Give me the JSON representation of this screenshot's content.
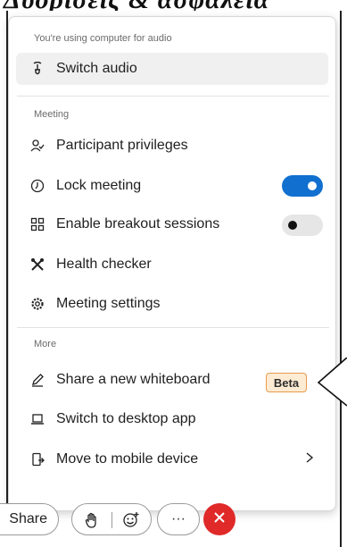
{
  "background_heading": "Δυορίσεις & ασφάλεια",
  "menu": {
    "audio_caption": "You're using computer for audio",
    "switch_audio": "Switch audio",
    "meeting_caption": "Meeting",
    "participant_privileges": "Participant privileges",
    "lock_meeting": "Lock meeting",
    "lock_meeting_on": true,
    "enable_breakout": "Enable breakout sessions",
    "enable_breakout_on": false,
    "health_checker": "Health checker",
    "meeting_settings": "Meeting settings",
    "more_caption": "More",
    "share_whiteboard": "Share a new whiteboard",
    "beta_badge": "Beta",
    "switch_desktop": "Switch to desktop app",
    "move_mobile": "Move to mobile device"
  },
  "toolbar": {
    "share_label": "Share",
    "more_glyph": "···"
  },
  "colors": {
    "toggle_on": "#1170cf",
    "end_call": "#e02929",
    "beta_bg": "#fdebd3",
    "beta_border": "#e99b4b"
  },
  "icons": [
    "headset-icon",
    "participants-icon",
    "lock-icon",
    "breakout-icon",
    "health-checker-icon",
    "gear-icon",
    "pencil-icon",
    "laptop-icon",
    "mobile-transfer-icon",
    "chevron-right-icon",
    "raise-hand-icon",
    "smiley-icon",
    "close-icon"
  ]
}
